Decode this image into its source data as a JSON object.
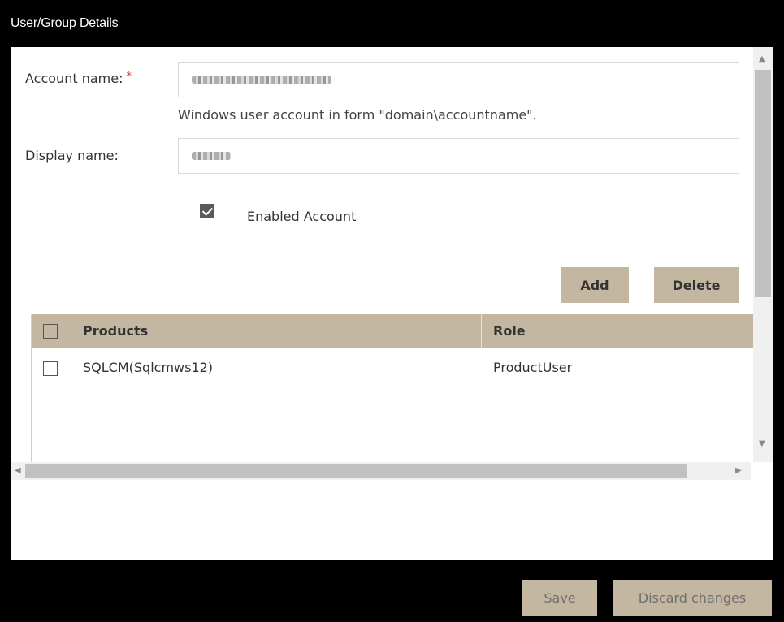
{
  "window": {
    "title": "User/Group Details"
  },
  "form": {
    "account_label": "Account name:",
    "required_mark": "*",
    "account_hint": "Windows user account in form \"domain\\accountname\".",
    "display_label": "Display name:",
    "enabled_label": "Enabled Account",
    "enabled_checked": true
  },
  "actions": {
    "add_label": "Add",
    "delete_label": "Delete"
  },
  "grid": {
    "columns": [
      "Products",
      "Role"
    ],
    "rows": [
      {
        "product": "SQLCM(Sqlcmws12)",
        "role": "ProductUser",
        "checked": false
      }
    ]
  },
  "footer": {
    "save_label": "Save",
    "discard_label": "Discard changes"
  },
  "colors": {
    "accent": "#c4b7a1",
    "background": "#000000",
    "required": "#c0392b"
  }
}
